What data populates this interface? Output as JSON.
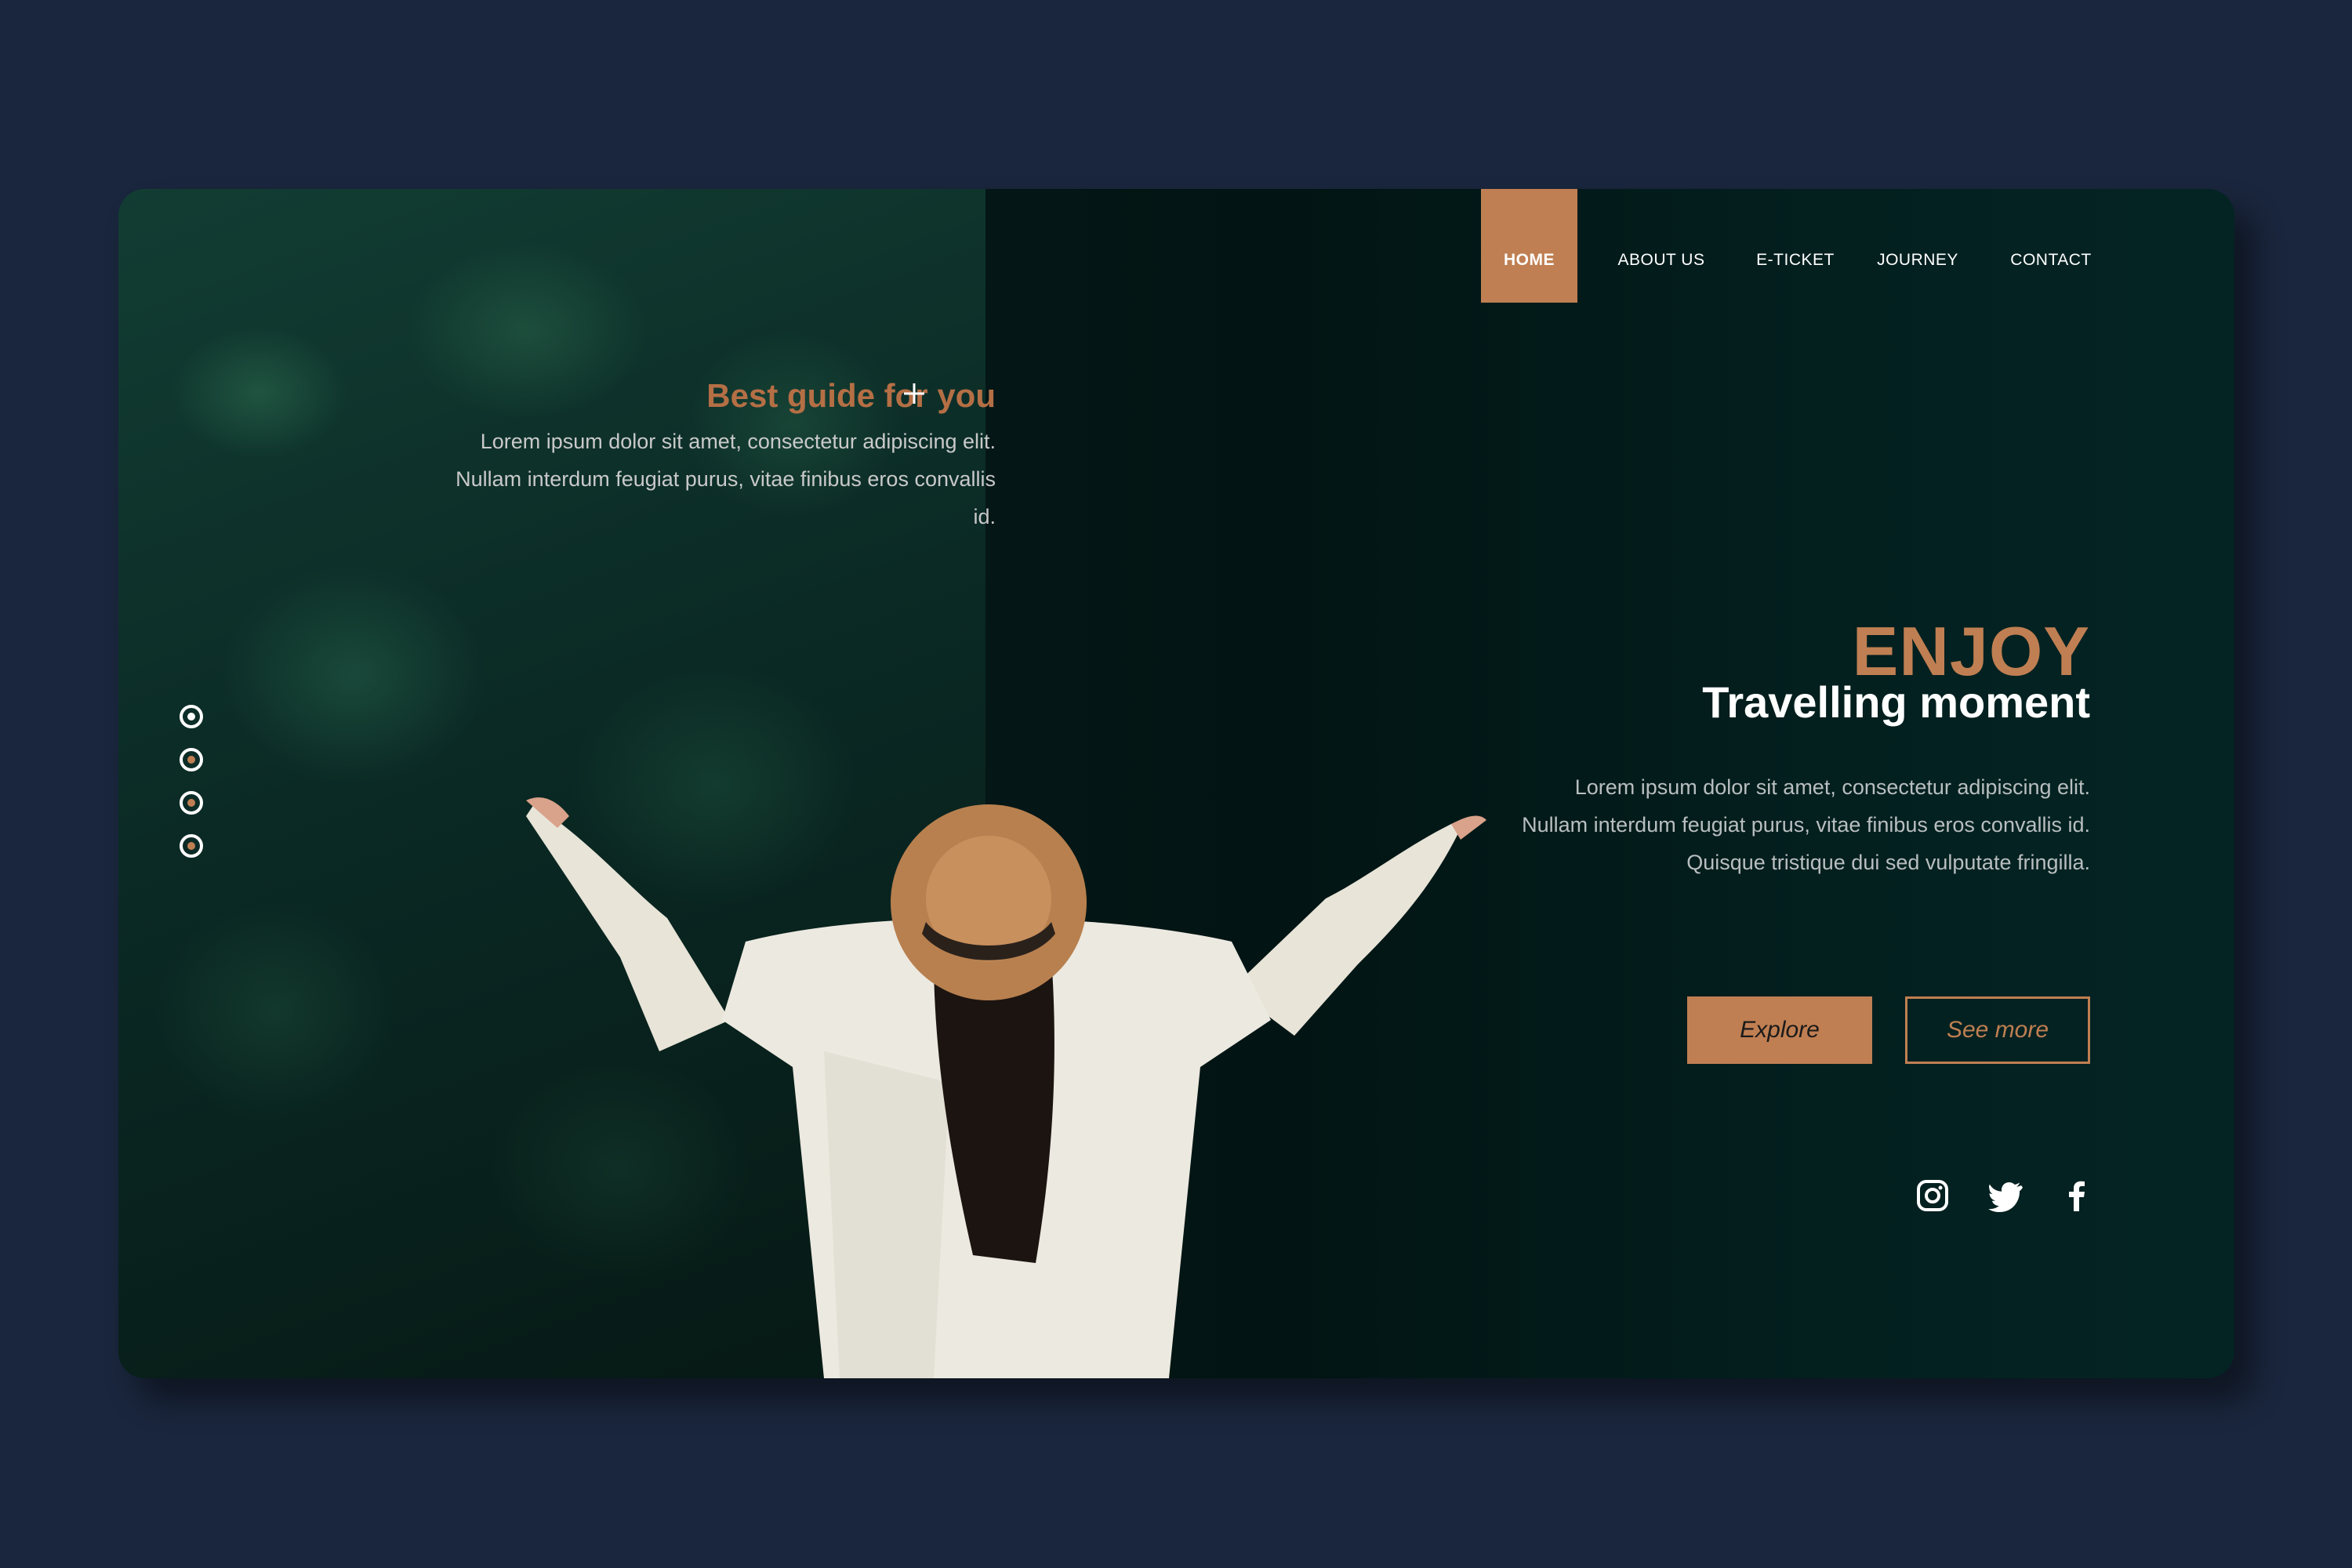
{
  "nav": {
    "items": [
      {
        "label": "HOME",
        "active": true
      },
      {
        "label": "ABOUT US"
      },
      {
        "label": "E-TICKET"
      },
      {
        "label": "JOURNEY"
      },
      {
        "label": "CONTACT"
      }
    ]
  },
  "guide": {
    "title": "Best guide for you",
    "text": "Lorem ipsum dolor sit amet, consectetur adipiscing elit. Nullam interdum feugiat purus, vitae finibus eros convallis id."
  },
  "hero": {
    "heading": "ENJOY",
    "subheading": "Travelling moment",
    "text": "Lorem ipsum dolor sit amet, consectetur adipiscing elit. Nullam interdum feugiat purus, vitae finibus eros convallis id. Quisque tristique dui sed vulputate fringilla."
  },
  "buttons": {
    "explore": "Explore",
    "see_more": "See more"
  },
  "slider": {
    "count": 4,
    "active_index": 0
  },
  "social": [
    "instagram-icon",
    "twitter-icon",
    "facebook-icon"
  ],
  "colors": {
    "accent": "#c07f52",
    "background": "#1a263d",
    "panel": "#031d1f"
  }
}
